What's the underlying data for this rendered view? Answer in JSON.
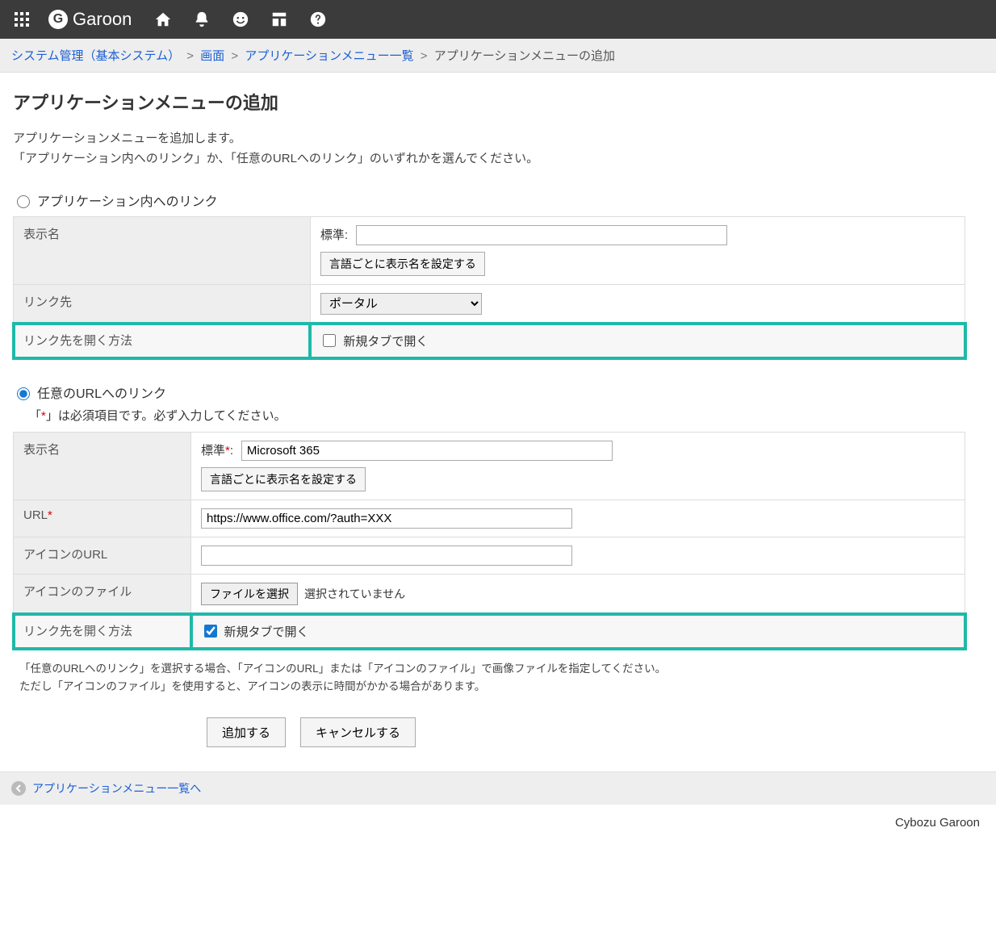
{
  "topbar": {
    "brand": "Garoon"
  },
  "breadcrumbs": {
    "items": [
      "システム管理（基本システム）",
      "画面",
      "アプリケーションメニュー一覧"
    ],
    "current": "アプリケーションメニューの追加",
    "sep": ">"
  },
  "page_title": "アプリケーションメニューの追加",
  "intro": {
    "line1": "アプリケーションメニューを追加します。",
    "line2": "「アプリケーション内へのリンク」か、「任意のURLへのリンク」のいずれかを選んでください。"
  },
  "section_app": {
    "radio_label": "アプリケーション内へのリンク",
    "radio_checked": false,
    "rows": {
      "display_name_label": "表示名",
      "standard_label": "標準:",
      "standard_value": "",
      "lang_button": "言語ごとに表示名を設定する",
      "link_target_label": "リンク先",
      "link_target_selected": "ポータル",
      "open_method_label": "リンク先を開く方法",
      "open_method_checkbox_label": "新規タブで開く",
      "open_method_checked": false
    }
  },
  "section_url": {
    "radio_label": "任意のURLへのリンク",
    "radio_checked": true,
    "hint": "「*」は必須項目です。必ず入力してください。",
    "rows": {
      "display_name_label": "表示名",
      "standard_label": "標準*:",
      "standard_value": "Microsoft 365",
      "lang_button": "言語ごとに表示名を設定する",
      "url_label": "URL*",
      "url_value": "https://www.office.com/?auth=XXX",
      "icon_url_label": "アイコンのURL",
      "icon_url_value": "",
      "icon_file_label": "アイコンのファイル",
      "icon_file_button": "ファイルを選択",
      "icon_file_status": "選択されていません",
      "open_method_label": "リンク先を開く方法",
      "open_method_checkbox_label": "新規タブで開く",
      "open_method_checked": true
    },
    "note_line1": "「任意のURLへのリンク」を選択する場合、「アイコンのURL」または「アイコンのファイル」で画像ファイルを指定してください。",
    "note_line2": "ただし「アイコンのファイル」を使用すると、アイコンの表示に時間がかかる場合があります。"
  },
  "buttons": {
    "submit": "追加する",
    "cancel": "キャンセルする"
  },
  "backlink": "アプリケーションメニュー一覧へ",
  "footer": "Cybozu Garoon"
}
